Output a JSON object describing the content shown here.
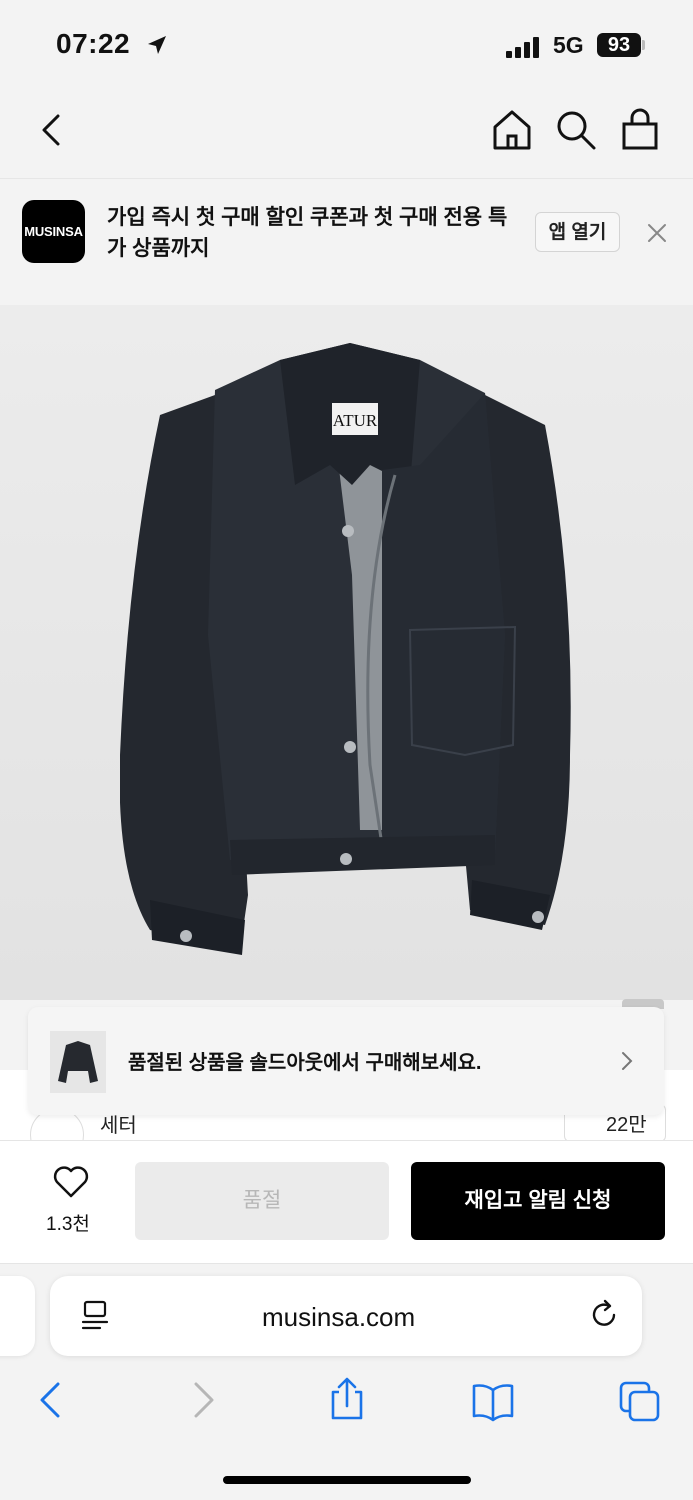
{
  "status_bar": {
    "time": "07:22",
    "network": "5G",
    "battery": "93"
  },
  "nav": {
    "icons": [
      "back-chevron-icon",
      "home-icon",
      "search-icon",
      "shopping-bag-icon"
    ]
  },
  "app_banner": {
    "logo_text": "MUSINSA",
    "message": "가입 즉시 첫 구매 할인 쿠폰과 첫 구매 전용 특가 상품까지",
    "open_app_label": "앱 열기"
  },
  "product": {
    "label_text": "ATUR"
  },
  "soldout_card": {
    "message": "품절된 상품을 솔드아웃에서 구매해보세요."
  },
  "brand_row": {
    "brand_name": "세터",
    "like_count": "22만"
  },
  "purchase_bar": {
    "like_total": "1.3천",
    "soldout_label": "품절",
    "restock_label": "재입고 알림 신청"
  },
  "safari": {
    "url": "musinsa.com",
    "toolbar_icons": [
      "back-icon",
      "forward-icon",
      "share-icon",
      "bookmarks-icon",
      "tabs-icon"
    ],
    "accent_color": "#1a73e8"
  }
}
